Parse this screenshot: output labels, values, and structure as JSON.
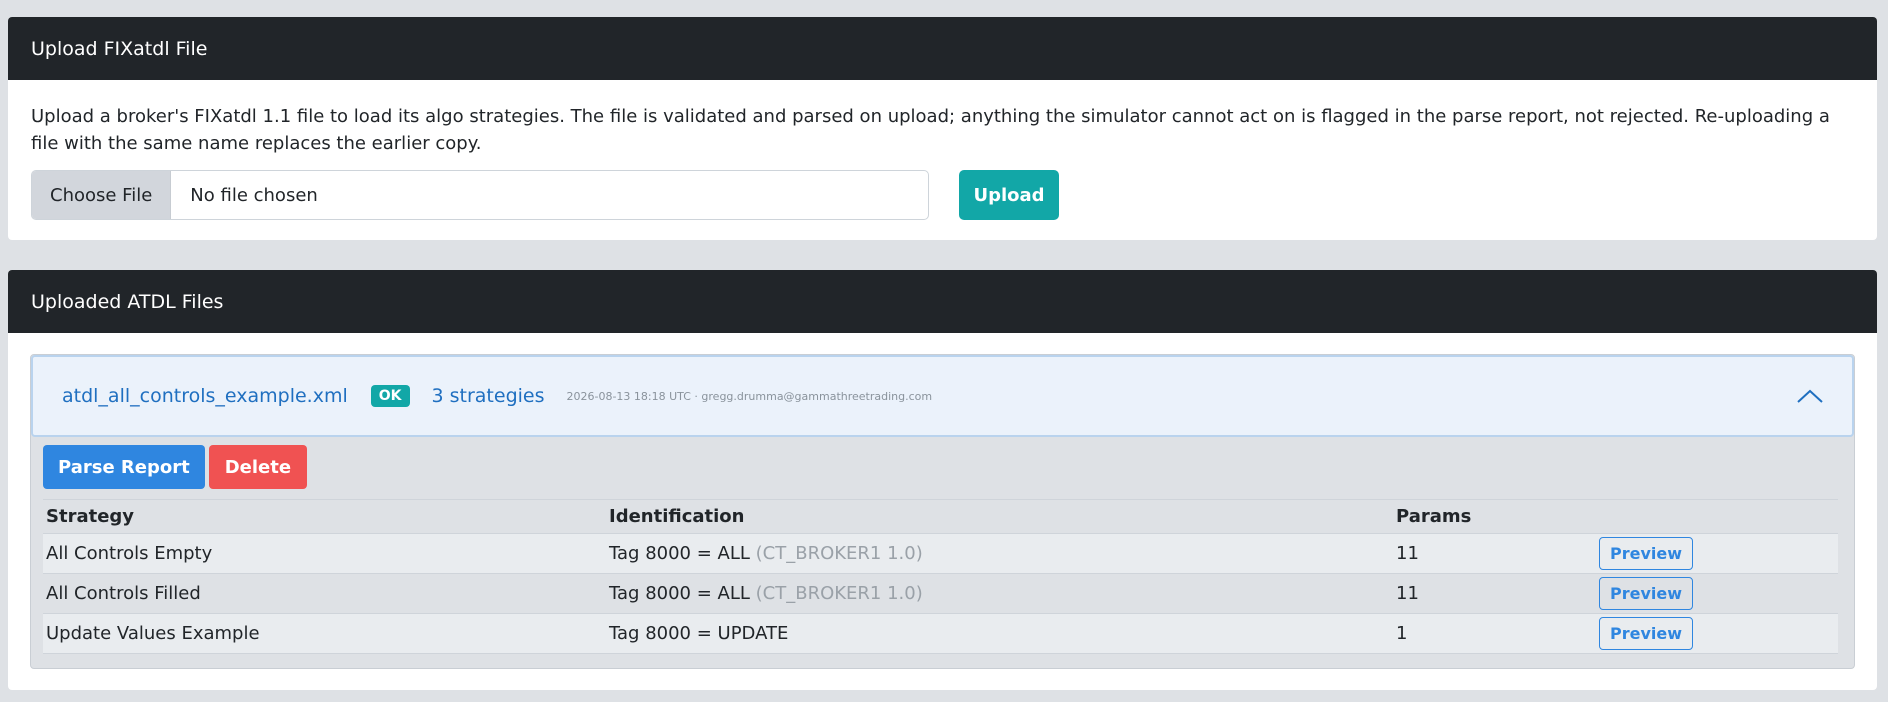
{
  "upload_card": {
    "title": "Upload FIXatdl File",
    "description": "Upload a broker's FIXatdl 1.1 file to load its algo strategies. The file is validated and parsed on upload; anything the simulator cannot act on is flagged in the parse report, not rejected. Re-uploading a file with the same name replaces the earlier copy.",
    "choose_file_label": "Choose File",
    "file_status": "No file chosen",
    "upload_label": "Upload"
  },
  "files_card": {
    "title": "Uploaded ATDL Files",
    "files": [
      {
        "name": "atdl_all_controls_example.xml",
        "status_badge": "OK",
        "strategies_count": "3 strategies",
        "meta": "2026-08-13 18:18 UTC · gregg.drumma@gammathreetrading.com",
        "expanded": true,
        "actions": {
          "parse_report_label": "Parse Report",
          "delete_label": "Delete"
        },
        "columns": [
          "Strategy",
          "Identification",
          "Params",
          ""
        ],
        "strategies": [
          {
            "name": "All Controls Empty",
            "identification": "Tag 8000 = ALL",
            "provider": "(CT_BROKER1 1.0)",
            "params": "11",
            "preview_label": "Preview"
          },
          {
            "name": "All Controls Filled",
            "identification": "Tag 8000 = ALL",
            "provider": "(CT_BROKER1 1.0)",
            "params": "11",
            "preview_label": "Preview"
          },
          {
            "name": "Update Values Example",
            "identification": "Tag 8000 = UPDATE",
            "provider": "",
            "params": "1",
            "preview_label": "Preview"
          }
        ]
      }
    ]
  },
  "icons": {
    "collapse": "chevron-up-icon"
  },
  "colors": {
    "page_bg": "#dee1e5",
    "header_bg": "#212529",
    "accent_teal": "#12a7a7",
    "primary_blue": "#2f86e0",
    "danger_red": "#f05252",
    "link_blue": "#1f6fc0"
  }
}
